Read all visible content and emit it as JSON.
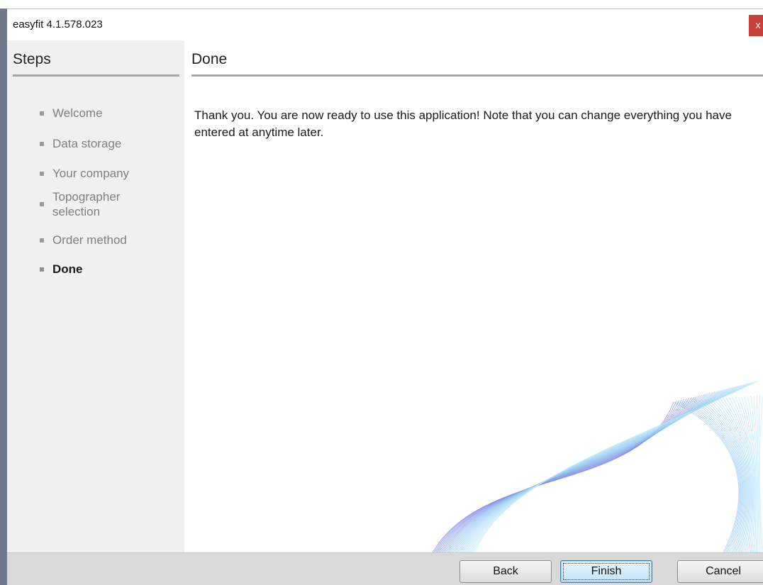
{
  "window": {
    "title": "easyfit 4.1.578.023",
    "close_glyph": "x"
  },
  "sidebar": {
    "title": "Steps",
    "steps": [
      {
        "label": "Welcome",
        "active": false
      },
      {
        "label": "Data storage",
        "active": false
      },
      {
        "label": "Your company",
        "active": false
      },
      {
        "label": "Topographer selection",
        "active": false
      },
      {
        "label": "Order method",
        "active": false
      },
      {
        "label": "Done",
        "active": true
      }
    ]
  },
  "content": {
    "title": "Done",
    "message": "Thank you. You are now ready to use this application! Note that you can change everything you have entered at anytime later."
  },
  "footer": {
    "back_label": "Back",
    "finish_label": "Finish",
    "cancel_label": "Cancel"
  },
  "colors": {
    "close_button": "#c7413a",
    "wave_light": "#b8e8fb",
    "wave_mid": "#8fc4f0",
    "wave_dark": "#7f7fe0",
    "primary_button_border": "#3c7fb1"
  }
}
